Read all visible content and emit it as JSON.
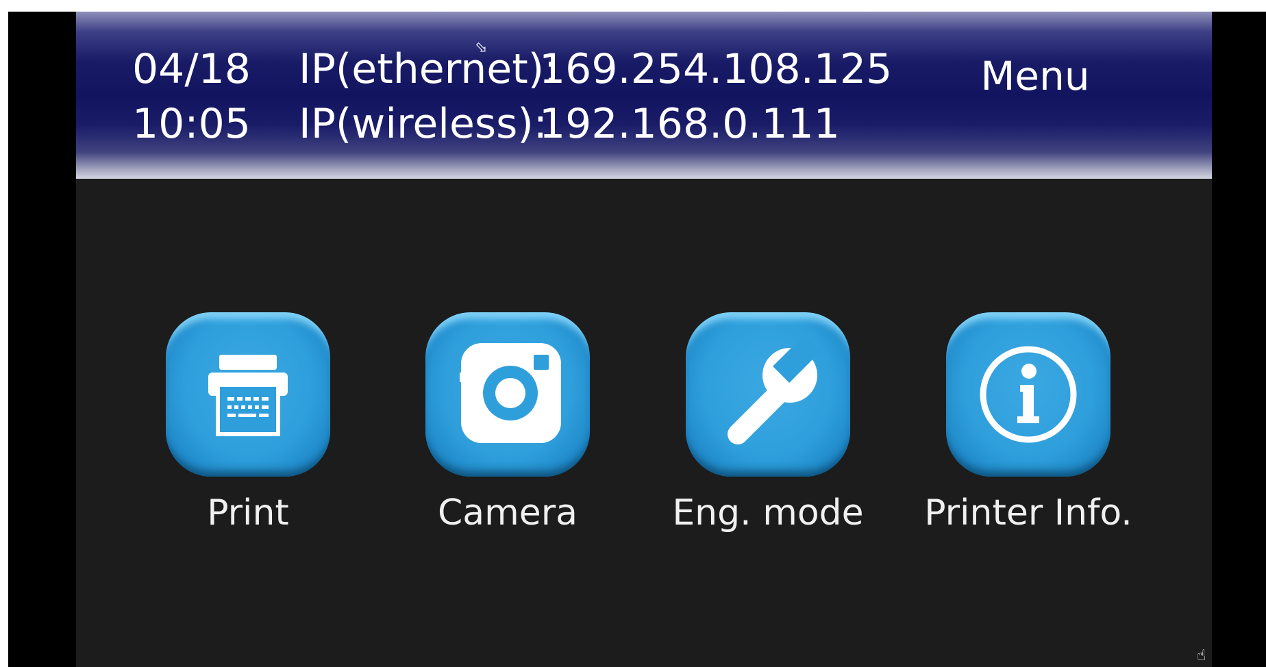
{
  "header": {
    "date": "04/18",
    "time": "10:05",
    "ip_ethernet_label": "IP(ethernet):",
    "ip_ethernet_value": "169.254.108.125",
    "ip_wireless_label": "IP(wireless):",
    "ip_wireless_value": "192.168.0.111",
    "menu_label": "Menu"
  },
  "apps": [
    {
      "label": "Print",
      "icon": "printer-icon"
    },
    {
      "label": "Camera",
      "icon": "camera-icon"
    },
    {
      "label": "Eng. mode",
      "icon": "wrench-icon"
    },
    {
      "label": "Printer Info.",
      "icon": "info-icon"
    }
  ],
  "colors": {
    "header_dark": "#121460",
    "button_blue": "#2f9fdc",
    "screen_bg": "#1c1c1c"
  }
}
